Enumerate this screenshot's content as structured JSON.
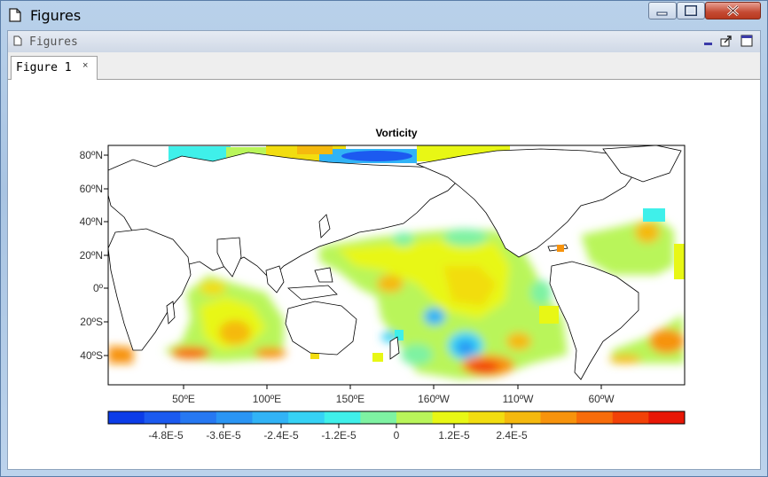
{
  "window": {
    "title": "Figures"
  },
  "dock": {
    "title": "Figures"
  },
  "tabs": [
    {
      "label": "Figure 1",
      "close": "×"
    }
  ],
  "figure": {
    "title": "Vorticity",
    "y_ticks": [
      "80ºN",
      "60ºN",
      "40ºN",
      "20ºN",
      "0º",
      "20ºS",
      "40ºS"
    ],
    "x_ticks": [
      "50ºE",
      "100ºE",
      "150ºE",
      "160ºW",
      "110ºW",
      "60ºW"
    ],
    "colorbar_labels": [
      "-4.8E-5",
      "-3.6E-5",
      "-2.4E-5",
      "-1.2E-5",
      "0",
      "1.2E-5",
      "2.4E-5"
    ],
    "colorbar_colors": [
      "#0c3ce8",
      "#1c5af0",
      "#2678f2",
      "#2a95f4",
      "#31b3f6",
      "#36d2f5",
      "#3ff0ea",
      "#7ef2a2",
      "#b9f55a",
      "#e8f715",
      "#f2dd10",
      "#f5b90e",
      "#f7930c",
      "#f76c0a",
      "#f24108",
      "#e81706"
    ]
  },
  "chart_data": {
    "type": "heatmap",
    "title": "Vorticity",
    "y_ticks": [
      "80ºN",
      "60ºN",
      "40ºN",
      "20ºN",
      "0º",
      "20ºS",
      "40ºS"
    ],
    "x_ticks": [
      "50ºE",
      "100ºE",
      "150ºE",
      "160ºW",
      "110ºW",
      "60ºW"
    ],
    "colorbar": {
      "min": -6e-05,
      "max": 6e-05,
      "tick_values": [
        -4.8e-05,
        -3.6e-05,
        -2.4e-05,
        -1.2e-05,
        0,
        1.2e-05,
        2.4e-05
      ]
    }
  }
}
